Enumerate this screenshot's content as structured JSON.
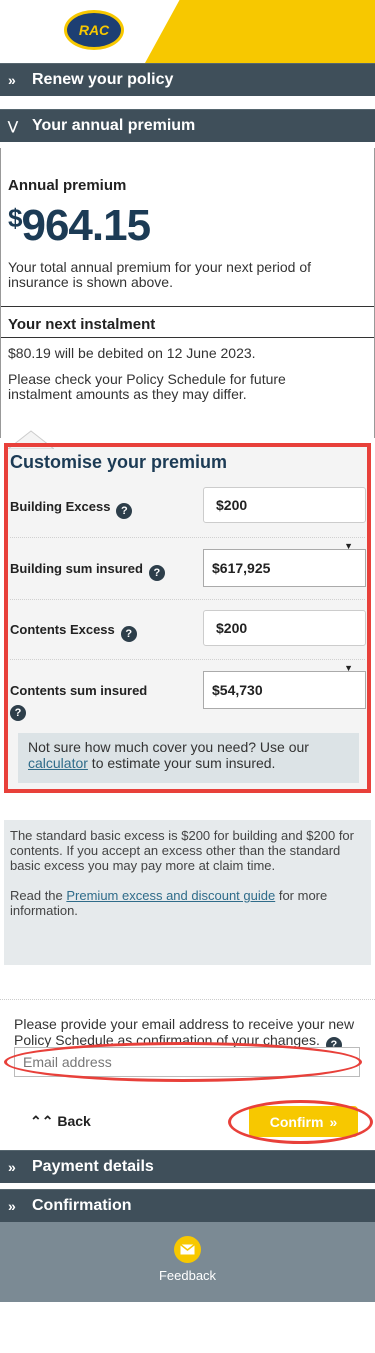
{
  "header": {
    "logo_text": "RAC"
  },
  "accordion": {
    "renew": "Renew your policy",
    "annual": "Your annual premium",
    "payment": "Payment details",
    "confirmation": "Confirmation",
    "chev_closed": "»",
    "chev_open": "«"
  },
  "premium": {
    "label": "Annual premium",
    "currency": "$",
    "amount": "964.15",
    "desc": "Your total annual premium for your next period of insurance is shown above.",
    "instalment_label": "Your next instalment",
    "instalment_text": "$80.19 will be debited on 12 June 2023.",
    "instalment_note": "Please check your Policy Schedule for future instalment amounts as they may differ."
  },
  "customise": {
    "title": "Customise your premium",
    "building_excess_label": "Building Excess",
    "building_excess_value": "$200",
    "building_sum_label": "Building sum insured",
    "building_sum_value": "$617,925",
    "contents_excess_label": "Contents Excess",
    "contents_excess_value": "$200",
    "contents_sum_label": "Contents sum insured",
    "contents_sum_value": "$54,730",
    "note_pre": "Not sure how much cover you need? Use our ",
    "note_link": "calculator",
    "note_post": " to estimate your sum insured."
  },
  "info": {
    "excess_text": "The standard basic excess is $200 for building and $200 for contents. If you accept an excess other than the standard basic excess you may pay more at claim time.",
    "guide_pre": "Read the ",
    "guide_link": "Premium excess and discount guide",
    "guide_post": " for more information."
  },
  "email": {
    "prompt": "Please provide your email address to receive your new Policy Schedule as confirmation of your changes.",
    "placeholder": "Email address"
  },
  "actions": {
    "back": "Back",
    "confirm": "Confirm"
  },
  "footer": {
    "feedback": "Feedback"
  }
}
